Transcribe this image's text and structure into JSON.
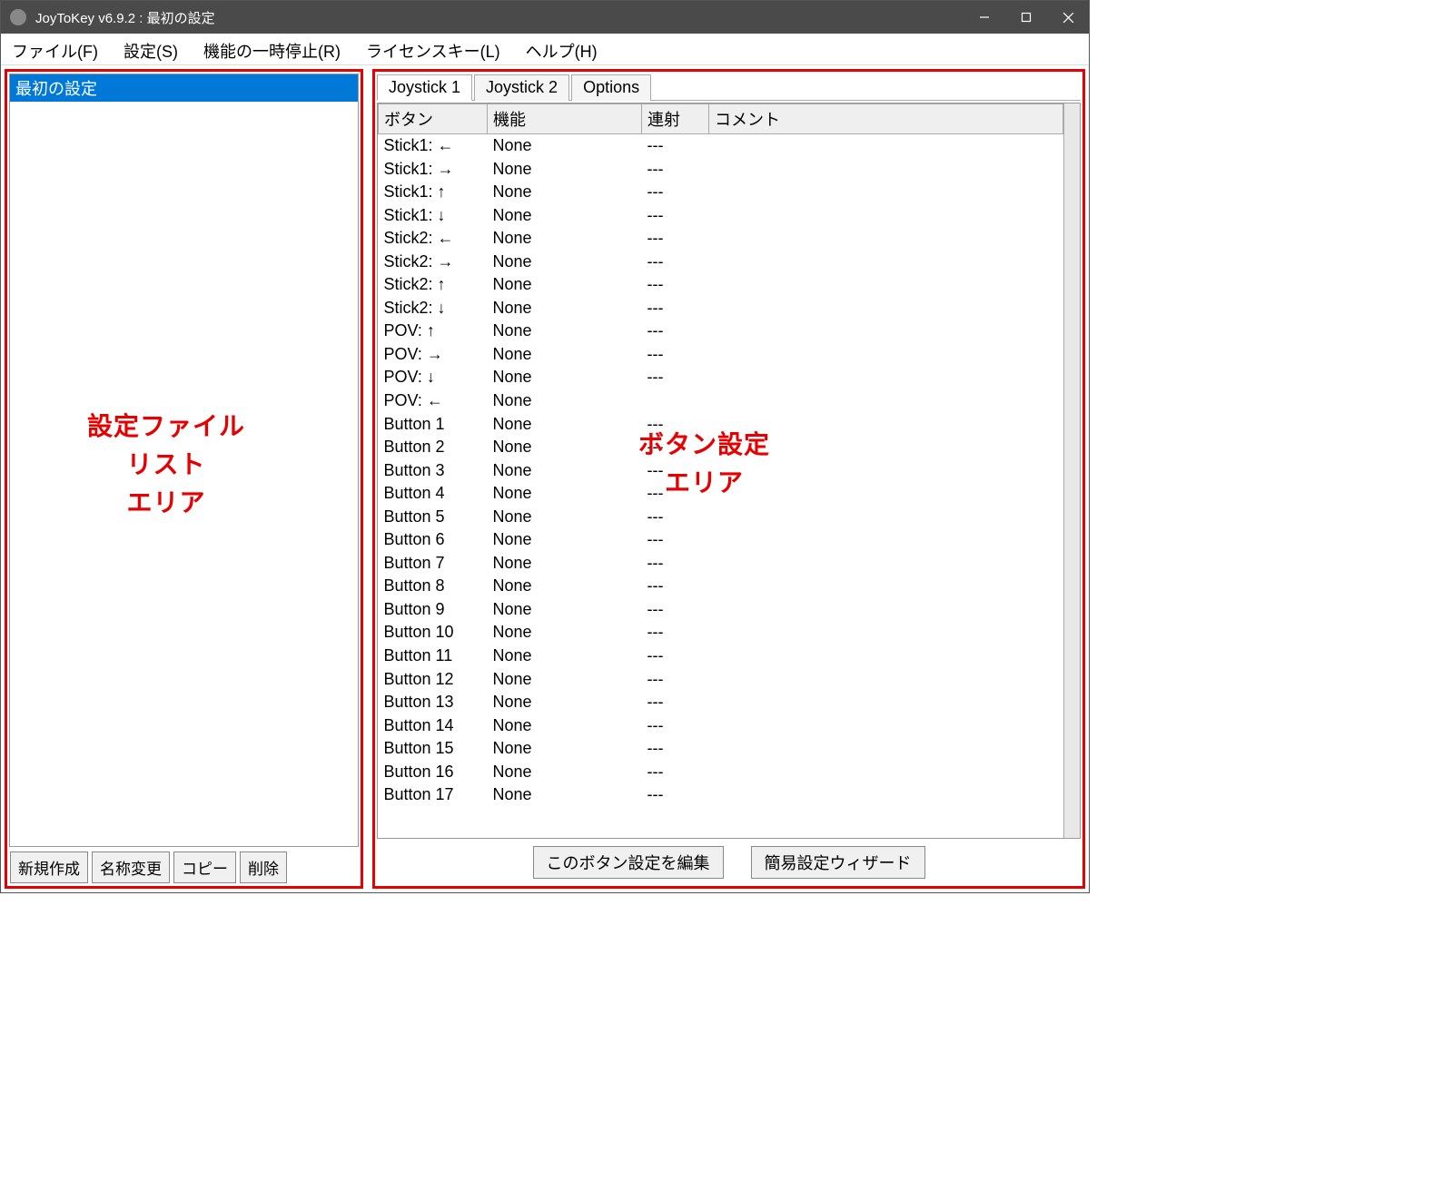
{
  "window": {
    "title": "JoyToKey v6.9.2 : 最初の設定"
  },
  "menu": {
    "items": [
      "ファイル(F)",
      "設定(S)",
      "機能の一時停止(R)",
      "ライセンスキー(L)",
      "ヘルプ(H)"
    ]
  },
  "sidebar": {
    "items": [
      "最初の設定"
    ],
    "buttons": [
      "新規作成",
      "名称変更",
      "コピー",
      "削除"
    ]
  },
  "tabs": {
    "items": [
      "Joystick 1",
      "Joystick 2",
      "Options"
    ],
    "active": 0
  },
  "table": {
    "headers": [
      "ボタン",
      "機能",
      "連射",
      "コメント"
    ],
    "rows": [
      {
        "button": "Stick1: ←",
        "func": "None",
        "rapid": "---",
        "comment": ""
      },
      {
        "button": "Stick1: →",
        "func": "None",
        "rapid": "---",
        "comment": ""
      },
      {
        "button": "Stick1: ↑",
        "func": "None",
        "rapid": "---",
        "comment": ""
      },
      {
        "button": "Stick1: ↓",
        "func": "None",
        "rapid": "---",
        "comment": ""
      },
      {
        "button": "Stick2: ←",
        "func": "None",
        "rapid": "---",
        "comment": ""
      },
      {
        "button": "Stick2: →",
        "func": "None",
        "rapid": "---",
        "comment": ""
      },
      {
        "button": "Stick2: ↑",
        "func": "None",
        "rapid": "---",
        "comment": ""
      },
      {
        "button": "Stick2: ↓",
        "func": "None",
        "rapid": "---",
        "comment": ""
      },
      {
        "button": "POV: ↑",
        "func": "None",
        "rapid": "---",
        "comment": ""
      },
      {
        "button": "POV: →",
        "func": "None",
        "rapid": "---",
        "comment": ""
      },
      {
        "button": "POV: ↓",
        "func": "None",
        "rapid": "---",
        "comment": ""
      },
      {
        "button": "POV: ←",
        "func": "None",
        "rapid": "",
        "comment": ""
      },
      {
        "button": "Button 1",
        "func": "None",
        "rapid": "---",
        "comment": ""
      },
      {
        "button": "Button 2",
        "func": "None",
        "rapid": "---",
        "comment": ""
      },
      {
        "button": "Button 3",
        "func": "None",
        "rapid": "---",
        "comment": ""
      },
      {
        "button": "Button 4",
        "func": "None",
        "rapid": "---",
        "comment": ""
      },
      {
        "button": "Button 5",
        "func": "None",
        "rapid": "---",
        "comment": ""
      },
      {
        "button": "Button 6",
        "func": "None",
        "rapid": "---",
        "comment": ""
      },
      {
        "button": "Button 7",
        "func": "None",
        "rapid": "---",
        "comment": ""
      },
      {
        "button": "Button 8",
        "func": "None",
        "rapid": "---",
        "comment": ""
      },
      {
        "button": "Button 9",
        "func": "None",
        "rapid": "---",
        "comment": ""
      },
      {
        "button": "Button 10",
        "func": "None",
        "rapid": "---",
        "comment": ""
      },
      {
        "button": "Button 11",
        "func": "None",
        "rapid": "---",
        "comment": ""
      },
      {
        "button": "Button 12",
        "func": "None",
        "rapid": "---",
        "comment": ""
      },
      {
        "button": "Button 13",
        "func": "None",
        "rapid": "---",
        "comment": ""
      },
      {
        "button": "Button 14",
        "func": "None",
        "rapid": "---",
        "comment": ""
      },
      {
        "button": "Button 15",
        "func": "None",
        "rapid": "---",
        "comment": ""
      },
      {
        "button": "Button 16",
        "func": "None",
        "rapid": "---",
        "comment": ""
      },
      {
        "button": "Button 17",
        "func": "None",
        "rapid": "---",
        "comment": ""
      }
    ]
  },
  "bottomButtons": {
    "edit": "このボタン設定を編集",
    "wizard": "簡易設定ウィザード"
  },
  "annotations": {
    "sidebar": "設定ファイル\nリスト\nエリア",
    "main": "ボタン設定\nエリア"
  }
}
